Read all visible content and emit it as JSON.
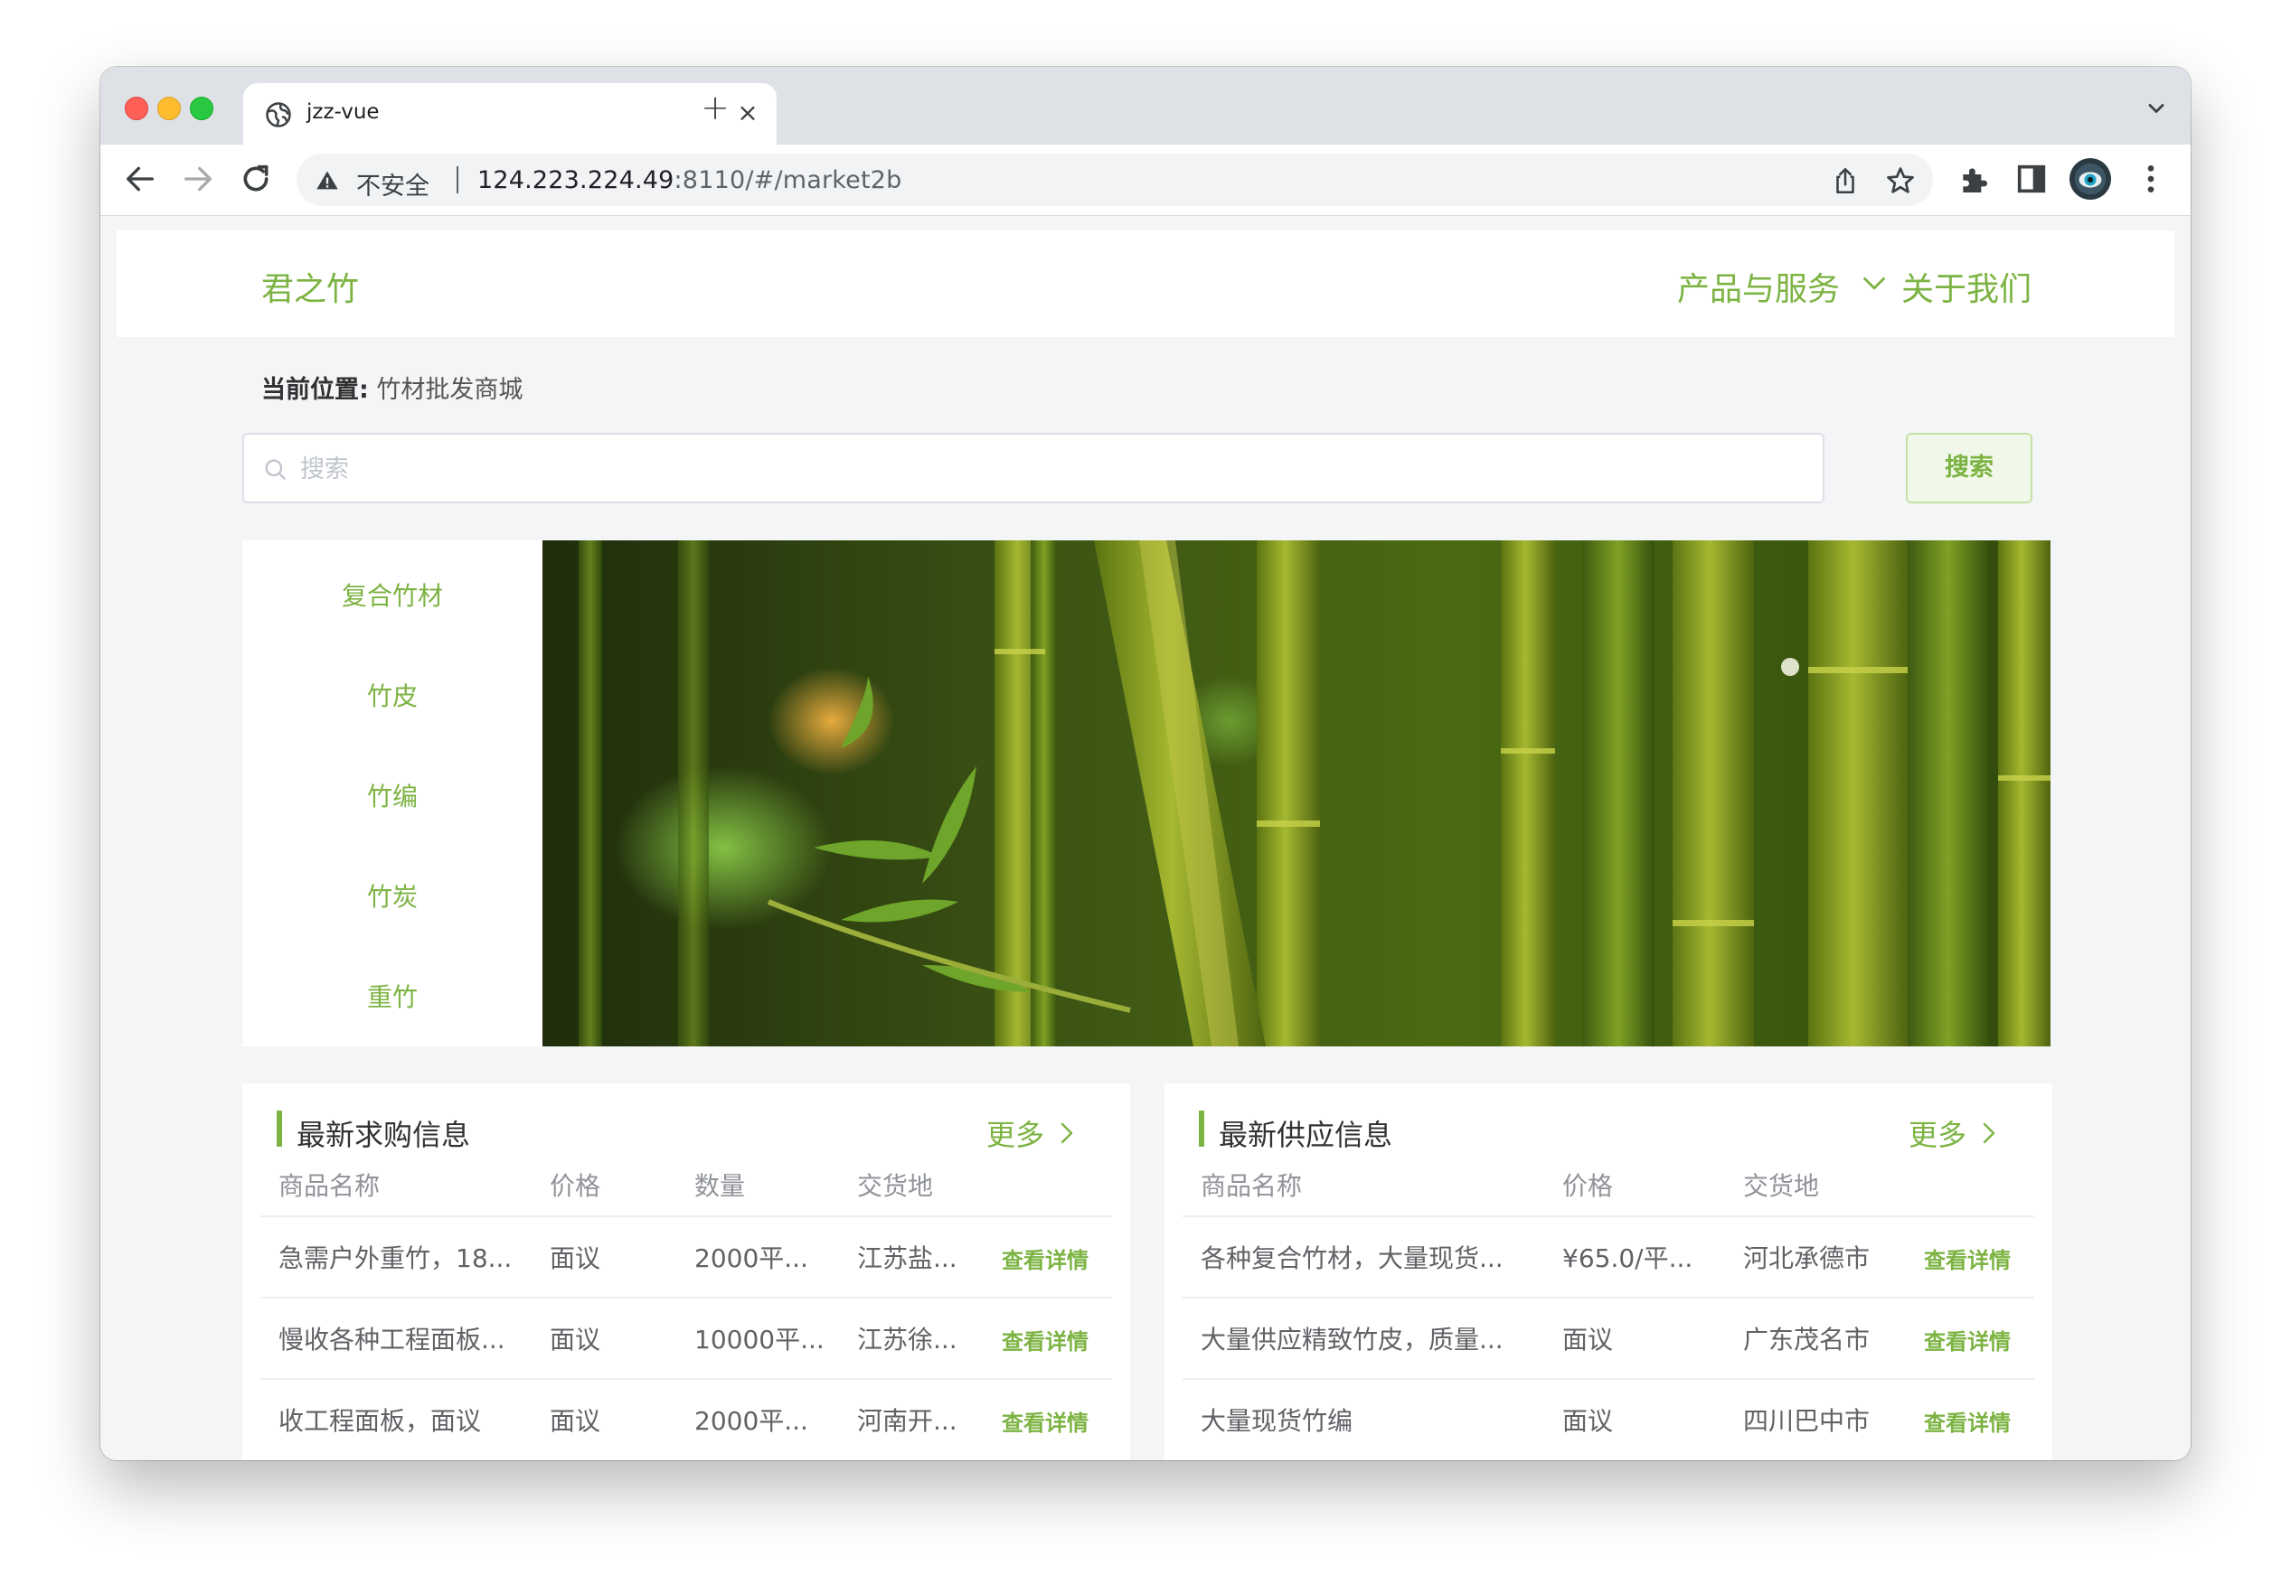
{
  "browser": {
    "tab_title": "jzz-vue",
    "tab_close": "×",
    "new_tab": "+",
    "security_label": "不安全",
    "url_host": "124.223.224.49",
    "url_rest": ":8110/#/market2b"
  },
  "header": {
    "brand": "君之竹",
    "nav_products": "产品与服务",
    "nav_about": "关于我们"
  },
  "breadcrumb": {
    "label": "当前位置:",
    "value": "竹材批发商城"
  },
  "search": {
    "placeholder": "搜索",
    "value": "",
    "button": "搜索"
  },
  "categories": [
    "复合竹材",
    "竹皮",
    "竹编",
    "竹炭",
    "重竹"
  ],
  "purchase": {
    "title": "最新求购信息",
    "more": "更多",
    "columns": [
      "商品名称",
      "价格",
      "数量",
      "交货地"
    ],
    "rows": [
      {
        "name": "急需户外重竹，18...",
        "price": "面议",
        "qty": "2000平...",
        "place": "江苏盐...",
        "action": "查看详情"
      },
      {
        "name": "慢收各种工程面板...",
        "price": "面议",
        "qty": "10000平...",
        "place": "江苏徐...",
        "action": "查看详情"
      },
      {
        "name": "收工程面板，面议",
        "price": "面议",
        "qty": "2000平...",
        "place": "河南开...",
        "action": "查看详情"
      }
    ]
  },
  "supply": {
    "title": "最新供应信息",
    "more": "更多",
    "columns": [
      "商品名称",
      "价格",
      "交货地"
    ],
    "rows": [
      {
        "name": "各种复合竹材，大量现货...",
        "price": "¥65.0/平...",
        "place": "河北承德市",
        "action": "查看详情"
      },
      {
        "name": "大量供应精致竹皮，质量...",
        "price": "面议",
        "place": "广东茂名市",
        "action": "查看详情"
      },
      {
        "name": "大量现货竹编",
        "price": "面议",
        "place": "四川巴中市",
        "action": "查看详情"
      }
    ]
  },
  "colors": {
    "accent": "#7cb342",
    "page_bg": "#f4f5f7"
  },
  "icons": [
    "globe-icon",
    "back-arrow-icon",
    "forward-arrow-icon",
    "reload-icon",
    "warning-icon",
    "share-icon",
    "star-icon",
    "extensions-icon",
    "sidepanel-icon",
    "avatar",
    "kebab-menu-icon",
    "search-icon",
    "chevron-down-icon",
    "chevron-right-icon"
  ]
}
